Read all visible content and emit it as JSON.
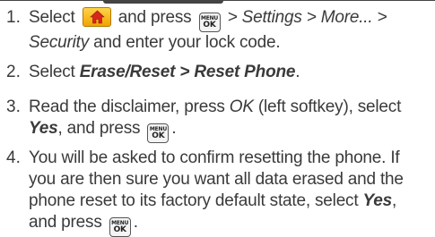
{
  "steps": [
    {
      "number": "1.",
      "parts": {
        "a": "Select",
        "b": "and press",
        "c": "> ",
        "d": "Settings",
        "e": " > ",
        "f": "More...",
        "g": " >",
        "h": "Security",
        "i": " and enter your lock code."
      }
    },
    {
      "number": "2.",
      "parts": {
        "a": "Select ",
        "b": "Erase/Reset",
        "c": " > ",
        "d": "Reset Phone",
        "e": "."
      }
    },
    {
      "number": "3.",
      "parts": {
        "a": "Read the disclaimer, press ",
        "b": "OK",
        "c": " (left softkey), select",
        "d": "Yes",
        "e": ", and press",
        "f": "."
      }
    },
    {
      "number": "4.",
      "lines": [
        "You will be asked to confirm resetting the phone. If",
        "you are then sure you want all data erased and the",
        "phone reset to its factory default state, select "
      ],
      "yes": "Yes",
      "comma": ",",
      "last_a": "and press",
      "last_b": "."
    }
  ],
  "keys": {
    "home_icon": "home-icon",
    "menu_ok_icon": "menu-ok-key-icon",
    "menu_top": "MENU",
    "menu_bottom": "OK",
    "home_color": "#f5b800"
  }
}
